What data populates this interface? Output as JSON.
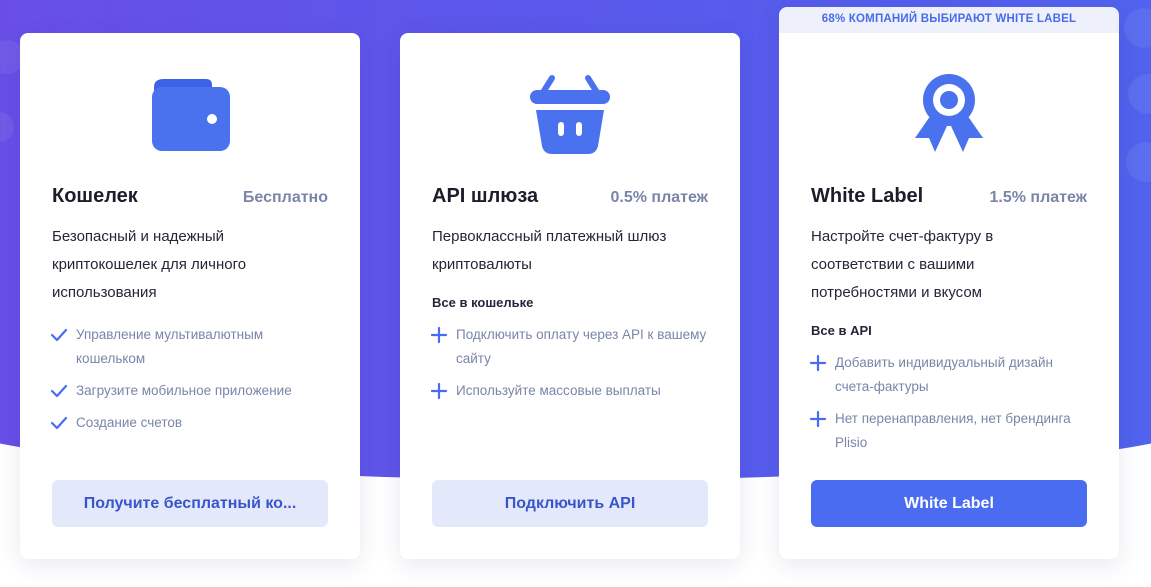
{
  "colors": {
    "accent": "#4a6cf0",
    "icon_blue": "#4a72ee",
    "muted": "#7a85a8",
    "heading": "#1c1d2b"
  },
  "cards": [
    {
      "icon": "wallet-icon",
      "title": "Кошелек",
      "price": "Бесплатно",
      "description": "Безопасный и надежный криптокошелек для личного использования",
      "subheading": "",
      "feature_mark": "check-icon",
      "features": [
        "Управление мультивалютным кошельком",
        "Загрузите мобильное приложение",
        "Создание счетов"
      ],
      "button": "Получите бесплатный ко..."
    },
    {
      "icon": "basket-icon",
      "title": "API шлюза",
      "price": "0.5% платеж",
      "description": "Первоклассный платежный шлюз криптовалюты",
      "subheading": "Все в кошельке",
      "feature_mark": "plus-icon",
      "features": [
        "Подключить оплату через API к вашему сайту",
        "Используйте массовые выплаты"
      ],
      "button": "Подключить API"
    },
    {
      "ribbon": "68% КОМПАНИЙ ВЫБИРАЮТ WHITE LABEL",
      "icon": "award-icon",
      "title": "White Label",
      "price": "1.5% платеж",
      "description": "Настройте счет-фактуру в соответствии с вашими потребностями и вкусом",
      "subheading": "Все в API",
      "feature_mark": "plus-icon",
      "features": [
        "Добавить индивидуальный дизайн счета-фактуры",
        "Нет перенаправления, нет брендинга Plisio"
      ],
      "button": "White Label"
    }
  ]
}
